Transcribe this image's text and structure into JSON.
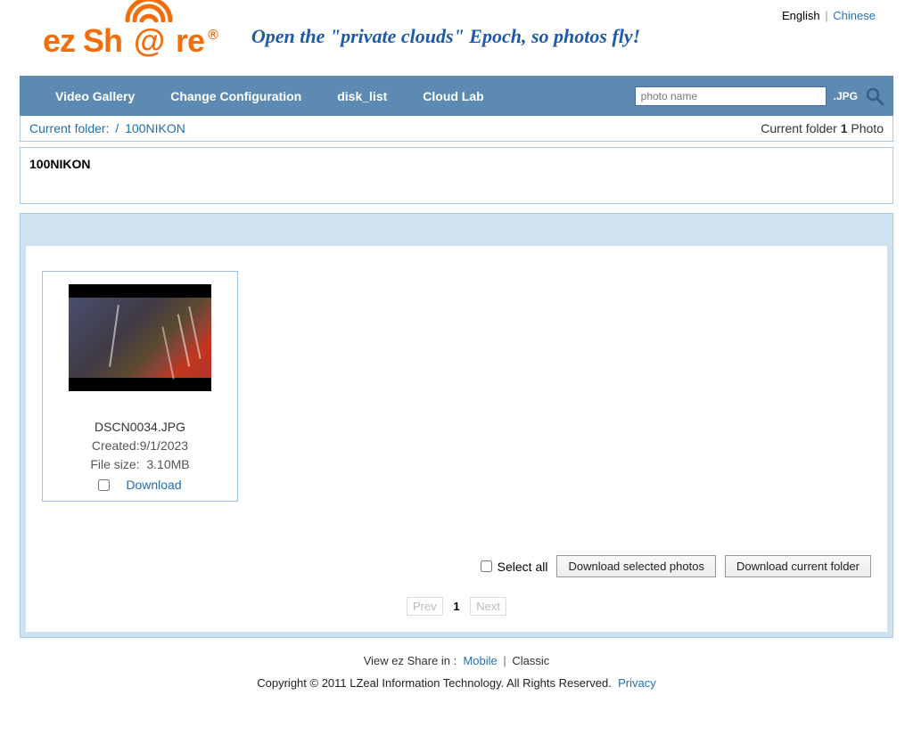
{
  "lang": {
    "english": "English",
    "chinese": "Chinese"
  },
  "logo": {
    "text_pre": "ez Sh",
    "text_post": "re",
    "reg": "®"
  },
  "slogan": "Open the \"private clouds\" Epoch, so photos fly!",
  "nav": {
    "items": [
      "Video Gallery",
      "Change Configuration",
      "disk_list",
      "Cloud Lab"
    ]
  },
  "search": {
    "placeholder": "photo name",
    "ext": ".JPG"
  },
  "breadcrumb": {
    "label": "Current folder:",
    "sep": "/",
    "folder": "100NIKON",
    "right_label": "Current folder",
    "count": "1",
    "unit": "Photo"
  },
  "folder_title": "100NIKON",
  "photos": [
    {
      "filename": "DSCN0034.JPG",
      "created_label": "Created:9/1/2023",
      "size_label": "File size:",
      "size_value": "3.10MB",
      "download": "Download"
    }
  ],
  "actions": {
    "select_all": "Select all",
    "dl_selected": "Download selected photos",
    "dl_folder": "Download current folder"
  },
  "pager": {
    "prev": "Prev",
    "current": "1",
    "next": "Next"
  },
  "footer": {
    "view_label": "View ez Share in :",
    "mobile": "Mobile",
    "classic": "Classic"
  },
  "copyright": {
    "text": "Copyright © 2011 LZeal Information Technology. All Rights Reserved.",
    "privacy": "Privacy"
  }
}
